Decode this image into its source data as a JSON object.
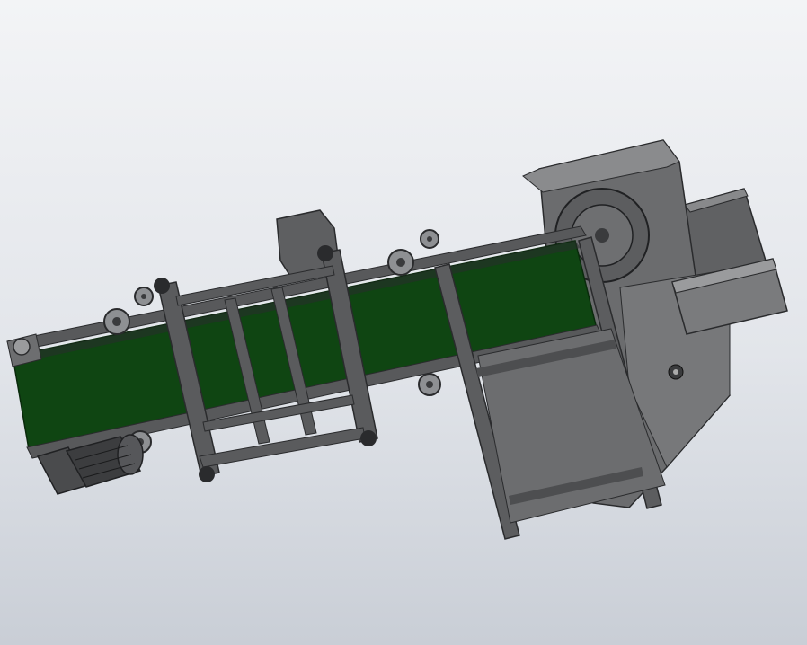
{
  "viewport": {
    "background_top": "#f3f4f6",
    "background_bottom": "#c9ced6"
  },
  "model": {
    "belt_color": "#0f4512",
    "frame_color": "#58595b",
    "frame_dark": "#2a2b2d",
    "housing_color": "#707173",
    "roller_color": "#8e9093",
    "parts": [
      "conveyor-belt",
      "support-frame",
      "drive-motor",
      "idler-rollers",
      "gearbox",
      "feed-housing",
      "hopper",
      "control-box",
      "access-door"
    ]
  }
}
